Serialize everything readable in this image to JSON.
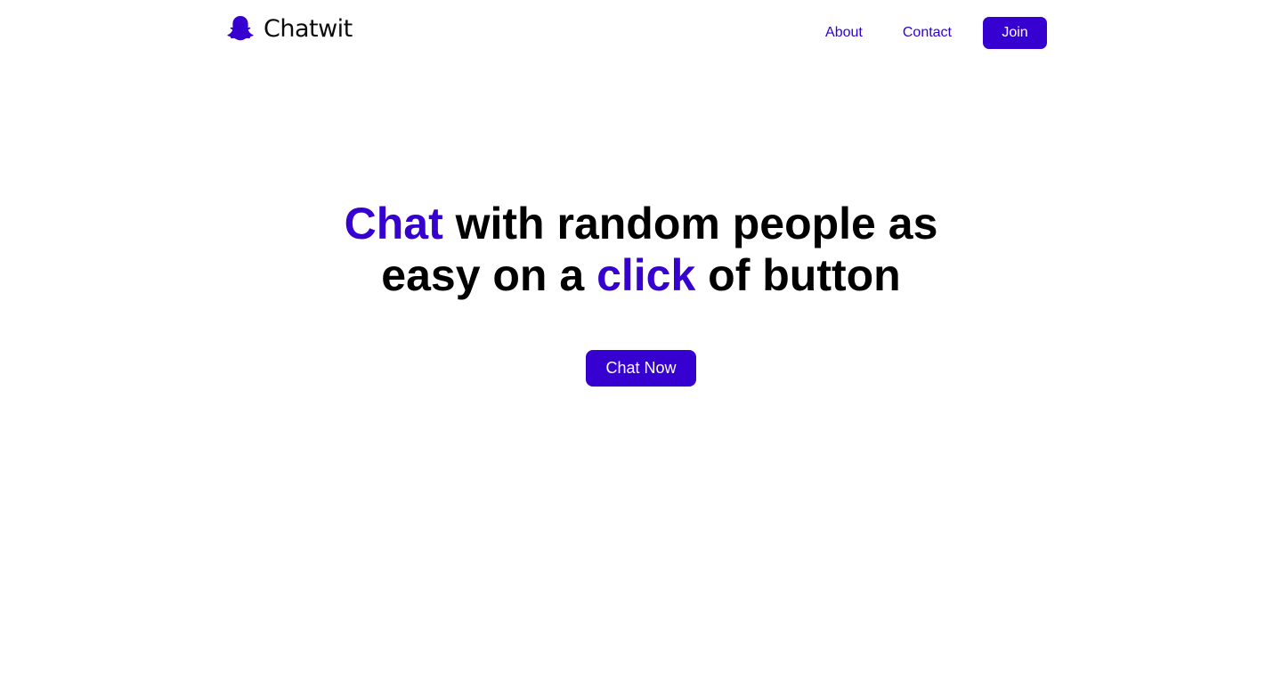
{
  "header": {
    "brand": "Chatwit",
    "logo_icon": "ghost-icon",
    "nav": {
      "about_label": "About",
      "contact_label": "Contact",
      "join_label": "Join"
    }
  },
  "hero": {
    "headline": {
      "line1_accent": "Chat",
      "line1_rest": " with random people as",
      "line2_start": "easy on a ",
      "line2_accent": "click",
      "line2_end": " of button"
    },
    "cta_label": "Chat Now"
  },
  "colors": {
    "accent": "#3600d1",
    "text": "#000000",
    "background": "#ffffff"
  }
}
